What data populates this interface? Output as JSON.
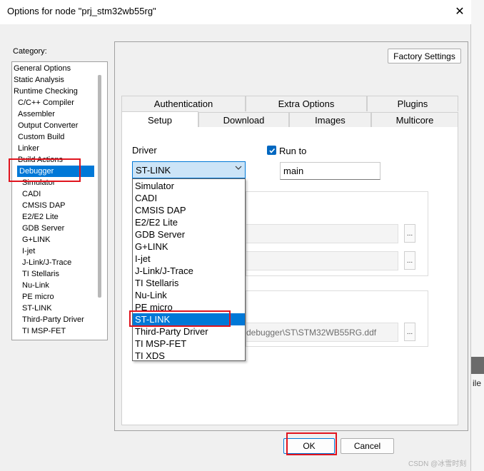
{
  "window": {
    "title": "Options for node \"prj_stm32wb55rg\"",
    "close_glyph": "✕",
    "side_text": "ile"
  },
  "category": {
    "label": "Category:",
    "items": [
      {
        "label": "General Options",
        "indent": 0
      },
      {
        "label": "Static Analysis",
        "indent": 0
      },
      {
        "label": "Runtime Checking",
        "indent": 0
      },
      {
        "label": "C/C++ Compiler",
        "indent": 1
      },
      {
        "label": "Assembler",
        "indent": 1
      },
      {
        "label": "Output Converter",
        "indent": 1
      },
      {
        "label": "Custom Build",
        "indent": 1
      },
      {
        "label": "Linker",
        "indent": 1
      },
      {
        "label": "Build Actions",
        "indent": 1
      },
      {
        "label": "Debugger",
        "indent": 1,
        "selected": true
      },
      {
        "label": "Simulator",
        "indent": 2
      },
      {
        "label": "CADI",
        "indent": 2
      },
      {
        "label": "CMSIS DAP",
        "indent": 2
      },
      {
        "label": "E2/E2 Lite",
        "indent": 2
      },
      {
        "label": "GDB Server",
        "indent": 2
      },
      {
        "label": "G+LINK",
        "indent": 2
      },
      {
        "label": "I-jet",
        "indent": 2
      },
      {
        "label": "J-Link/J-Trace",
        "indent": 2
      },
      {
        "label": "TI Stellaris",
        "indent": 2
      },
      {
        "label": "Nu-Link",
        "indent": 2
      },
      {
        "label": "PE micro",
        "indent": 2
      },
      {
        "label": "ST-LINK",
        "indent": 2
      },
      {
        "label": "Third-Party Driver",
        "indent": 2
      },
      {
        "label": "TI MSP-FET",
        "indent": 2
      }
    ]
  },
  "panel": {
    "factory_settings": "Factory Settings",
    "tabs_row1": [
      "Authentication",
      "Extra Options",
      "Plugins"
    ],
    "tabs_row2": [
      "Setup",
      "Download",
      "Images",
      "Multicore"
    ],
    "active_tab": "Setup"
  },
  "setup": {
    "driver_label": "Driver",
    "driver_value": "ST-LINK",
    "run_to_label": "Run to",
    "run_to_checked": true,
    "run_to_value": "main",
    "ddf_path_fragment": "debugger\\ST\\STM32WB55RG.ddf",
    "browse_glyph": "..."
  },
  "dropdown": {
    "options": [
      "Simulator",
      "CADI",
      "CMSIS DAP",
      "E2/E2 Lite",
      "GDB Server",
      "G+LINK",
      "I-jet",
      "J-Link/J-Trace",
      "TI Stellaris",
      "Nu-Link",
      "PE micro",
      "ST-LINK",
      "Third-Party Driver",
      "TI MSP-FET",
      "TI XDS"
    ],
    "selected": "ST-LINK"
  },
  "footer": {
    "ok": "OK",
    "cancel": "Cancel"
  },
  "watermark": "CSDN @冰雪时刻",
  "colors": {
    "selection": "#0078d7",
    "highlight_box": "#e0141e",
    "checkbox": "#0067c0"
  }
}
